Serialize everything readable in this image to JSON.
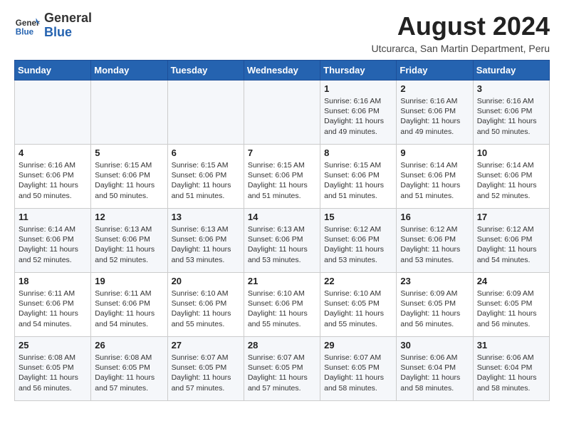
{
  "header": {
    "logo_general": "General",
    "logo_blue": "Blue",
    "title": "August 2024",
    "location": "Utcurarca, San Martin Department, Peru"
  },
  "days_of_week": [
    "Sunday",
    "Monday",
    "Tuesday",
    "Wednesday",
    "Thursday",
    "Friday",
    "Saturday"
  ],
  "weeks": [
    [
      {
        "day": "",
        "text": ""
      },
      {
        "day": "",
        "text": ""
      },
      {
        "day": "",
        "text": ""
      },
      {
        "day": "",
        "text": ""
      },
      {
        "day": "1",
        "text": "Sunrise: 6:16 AM\nSunset: 6:06 PM\nDaylight: 11 hours and 49 minutes."
      },
      {
        "day": "2",
        "text": "Sunrise: 6:16 AM\nSunset: 6:06 PM\nDaylight: 11 hours and 49 minutes."
      },
      {
        "day": "3",
        "text": "Sunrise: 6:16 AM\nSunset: 6:06 PM\nDaylight: 11 hours and 50 minutes."
      }
    ],
    [
      {
        "day": "4",
        "text": "Sunrise: 6:16 AM\nSunset: 6:06 PM\nDaylight: 11 hours and 50 minutes."
      },
      {
        "day": "5",
        "text": "Sunrise: 6:15 AM\nSunset: 6:06 PM\nDaylight: 11 hours and 50 minutes."
      },
      {
        "day": "6",
        "text": "Sunrise: 6:15 AM\nSunset: 6:06 PM\nDaylight: 11 hours and 51 minutes."
      },
      {
        "day": "7",
        "text": "Sunrise: 6:15 AM\nSunset: 6:06 PM\nDaylight: 11 hours and 51 minutes."
      },
      {
        "day": "8",
        "text": "Sunrise: 6:15 AM\nSunset: 6:06 PM\nDaylight: 11 hours and 51 minutes."
      },
      {
        "day": "9",
        "text": "Sunrise: 6:14 AM\nSunset: 6:06 PM\nDaylight: 11 hours and 51 minutes."
      },
      {
        "day": "10",
        "text": "Sunrise: 6:14 AM\nSunset: 6:06 PM\nDaylight: 11 hours and 52 minutes."
      }
    ],
    [
      {
        "day": "11",
        "text": "Sunrise: 6:14 AM\nSunset: 6:06 PM\nDaylight: 11 hours and 52 minutes."
      },
      {
        "day": "12",
        "text": "Sunrise: 6:13 AM\nSunset: 6:06 PM\nDaylight: 11 hours and 52 minutes."
      },
      {
        "day": "13",
        "text": "Sunrise: 6:13 AM\nSunset: 6:06 PM\nDaylight: 11 hours and 53 minutes."
      },
      {
        "day": "14",
        "text": "Sunrise: 6:13 AM\nSunset: 6:06 PM\nDaylight: 11 hours and 53 minutes."
      },
      {
        "day": "15",
        "text": "Sunrise: 6:12 AM\nSunset: 6:06 PM\nDaylight: 11 hours and 53 minutes."
      },
      {
        "day": "16",
        "text": "Sunrise: 6:12 AM\nSunset: 6:06 PM\nDaylight: 11 hours and 53 minutes."
      },
      {
        "day": "17",
        "text": "Sunrise: 6:12 AM\nSunset: 6:06 PM\nDaylight: 11 hours and 54 minutes."
      }
    ],
    [
      {
        "day": "18",
        "text": "Sunrise: 6:11 AM\nSunset: 6:06 PM\nDaylight: 11 hours and 54 minutes."
      },
      {
        "day": "19",
        "text": "Sunrise: 6:11 AM\nSunset: 6:06 PM\nDaylight: 11 hours and 54 minutes."
      },
      {
        "day": "20",
        "text": "Sunrise: 6:10 AM\nSunset: 6:06 PM\nDaylight: 11 hours and 55 minutes."
      },
      {
        "day": "21",
        "text": "Sunrise: 6:10 AM\nSunset: 6:06 PM\nDaylight: 11 hours and 55 minutes."
      },
      {
        "day": "22",
        "text": "Sunrise: 6:10 AM\nSunset: 6:05 PM\nDaylight: 11 hours and 55 minutes."
      },
      {
        "day": "23",
        "text": "Sunrise: 6:09 AM\nSunset: 6:05 PM\nDaylight: 11 hours and 56 minutes."
      },
      {
        "day": "24",
        "text": "Sunrise: 6:09 AM\nSunset: 6:05 PM\nDaylight: 11 hours and 56 minutes."
      }
    ],
    [
      {
        "day": "25",
        "text": "Sunrise: 6:08 AM\nSunset: 6:05 PM\nDaylight: 11 hours and 56 minutes."
      },
      {
        "day": "26",
        "text": "Sunrise: 6:08 AM\nSunset: 6:05 PM\nDaylight: 11 hours and 57 minutes."
      },
      {
        "day": "27",
        "text": "Sunrise: 6:07 AM\nSunset: 6:05 PM\nDaylight: 11 hours and 57 minutes."
      },
      {
        "day": "28",
        "text": "Sunrise: 6:07 AM\nSunset: 6:05 PM\nDaylight: 11 hours and 57 minutes."
      },
      {
        "day": "29",
        "text": "Sunrise: 6:07 AM\nSunset: 6:05 PM\nDaylight: 11 hours and 58 minutes."
      },
      {
        "day": "30",
        "text": "Sunrise: 6:06 AM\nSunset: 6:04 PM\nDaylight: 11 hours and 58 minutes."
      },
      {
        "day": "31",
        "text": "Sunrise: 6:06 AM\nSunset: 6:04 PM\nDaylight: 11 hours and 58 minutes."
      }
    ]
  ]
}
